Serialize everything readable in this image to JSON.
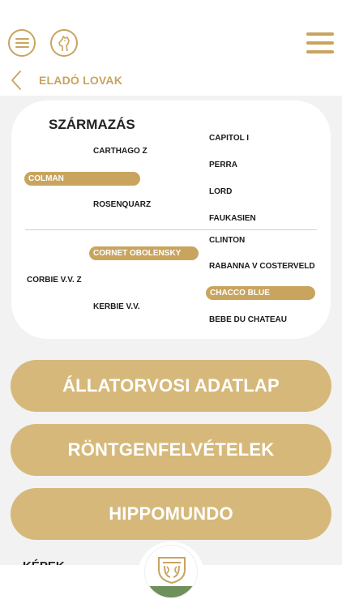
{
  "header": {
    "menu_icon": "list-circle-icon",
    "logo_icon": "horse-head-icon",
    "hamburger_icon": "hamburger-icon",
    "back_icon": "chevron-left-icon",
    "title": "ELADÓ LOVAK"
  },
  "pedigree": {
    "title": "SZÁRMAZÁS",
    "entries": [
      {
        "name": "CAPITOL I",
        "highlight": false
      },
      {
        "name": "CARTHAGO Z",
        "highlight": false
      },
      {
        "name": "PERRA",
        "highlight": false
      },
      {
        "name": "COLMAN",
        "highlight": true
      },
      {
        "name": "LORD",
        "highlight": false
      },
      {
        "name": "ROSENQUARZ",
        "highlight": false
      },
      {
        "name": "FAUKASIEN",
        "highlight": false
      },
      {
        "name": "CLINTON",
        "highlight": false
      },
      {
        "name": "CORNET OBOLENSKY",
        "highlight": true
      },
      {
        "name": "RABANNA V COSTERVELD",
        "highlight": false
      },
      {
        "name": "CORBIE V.V. Z",
        "highlight": false
      },
      {
        "name": "CHACCO BLUE",
        "highlight": true
      },
      {
        "name": "KERBIE V.V.",
        "highlight": false
      },
      {
        "name": "BEBE DU CHATEAU",
        "highlight": false
      }
    ]
  },
  "buttons": {
    "vet": "ÁLLATORVOSI ADATLAP",
    "xray": "RÖNTGENFELVÉTELEK",
    "hippomundo": "HIPPOMUNDO"
  },
  "section": {
    "images_title": "KÉPEK"
  },
  "bottom": {
    "logo_icon": "brand-shield-logo-icon"
  },
  "colors": {
    "gold": "#c9a45f",
    "button_gold": "#d6b97a",
    "background": "#f2f2f2"
  }
}
